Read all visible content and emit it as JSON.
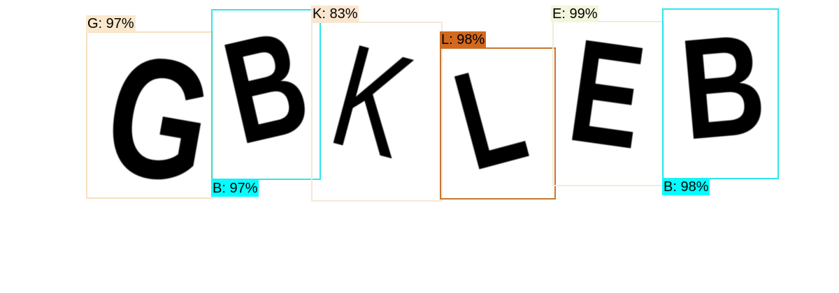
{
  "captcha": {
    "text": "GBKLEB",
    "glyphs": [
      "G",
      "B",
      "K",
      "L",
      "E",
      "B"
    ]
  },
  "detections": [
    {
      "label": "G: 97%",
      "color": "#fae8cc",
      "box_color": "#f7e0c0",
      "tag_text_color": "#000000"
    },
    {
      "label": "B: 97%",
      "color": "#00ffff",
      "box_color": "#2ee6ee",
      "tag_text_color": "#000000"
    },
    {
      "label": "K: 83%",
      "color": "#fae6cf",
      "box_color": "#f3e8d6",
      "tag_text_color": "#000000"
    },
    {
      "label": "L: 98%",
      "color": "#d2691e",
      "box_color": "#c8752e",
      "tag_text_color": "#000000"
    },
    {
      "label": "E: 99%",
      "color": "#f3f5dc",
      "box_color": "#f0ecd6",
      "tag_text_color": "#000000"
    },
    {
      "label": "B: 98%",
      "color": "#00ffff",
      "box_color": "#2ee6ee",
      "tag_text_color": "#000000"
    }
  ]
}
